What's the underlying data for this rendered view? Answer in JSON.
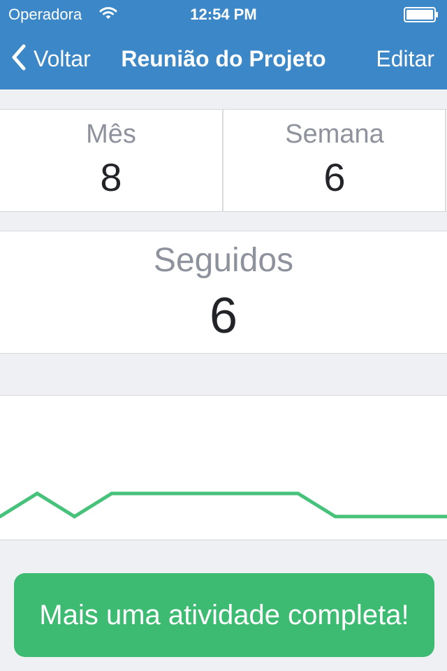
{
  "status_bar": {
    "carrier": "Operadora",
    "time": "12:54 PM",
    "wifi_icon": "wifi-icon",
    "battery_icon": "battery-icon"
  },
  "nav": {
    "back_label": "Voltar",
    "back_icon": "chevron-left-icon",
    "title": "Reunião do Projeto",
    "edit_label": "Editar"
  },
  "stats": {
    "month": {
      "label": "Mês",
      "value": "8"
    },
    "week": {
      "label": "Semana",
      "value": "6"
    }
  },
  "streak": {
    "label": "Seguidos",
    "value": "6"
  },
  "chart_data": {
    "type": "line",
    "values": [
      0,
      1,
      0,
      1,
      1,
      1,
      1,
      1,
      1,
      0,
      0,
      0,
      0
    ],
    "ylim": [
      0,
      1
    ],
    "color": "#46c27a",
    "grid": false
  },
  "action": {
    "label": "Mais uma atividade completa!",
    "color": "#3dbb72"
  },
  "colors": {
    "header": "#3b87c8",
    "background": "#eff0f4"
  }
}
